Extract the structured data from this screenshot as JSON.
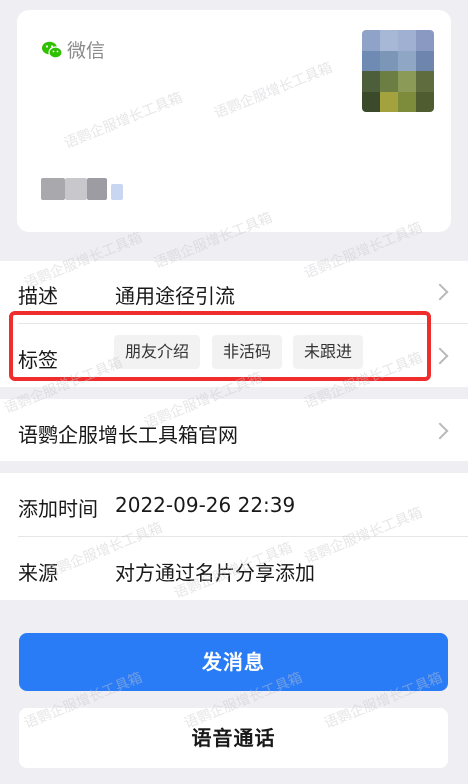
{
  "profile": {
    "source_label": "微信",
    "source_icon": "wechat-icon",
    "avatar_icon": "blurred-avatar"
  },
  "details": {
    "description": {
      "label": "描述",
      "value": "通用途径引流"
    },
    "tags": {
      "label": "标签",
      "items": [
        "朋友介绍",
        "非活码",
        "未跟进"
      ]
    }
  },
  "website": {
    "label": "语鹦企服增长工具箱官网"
  },
  "meta": {
    "added_time": {
      "label": "添加时间",
      "value": "2022-09-26 22:39"
    },
    "source": {
      "label": "来源",
      "value": "对方通过名片分享添加"
    }
  },
  "actions": {
    "send_message": "发消息",
    "voice_call": "语音通话"
  },
  "watermark": "语鹦企服增长工具箱",
  "colors": {
    "primary": "#2a7cf6",
    "highlight": "#f02d2d",
    "wechat_green": "#2dc100"
  }
}
